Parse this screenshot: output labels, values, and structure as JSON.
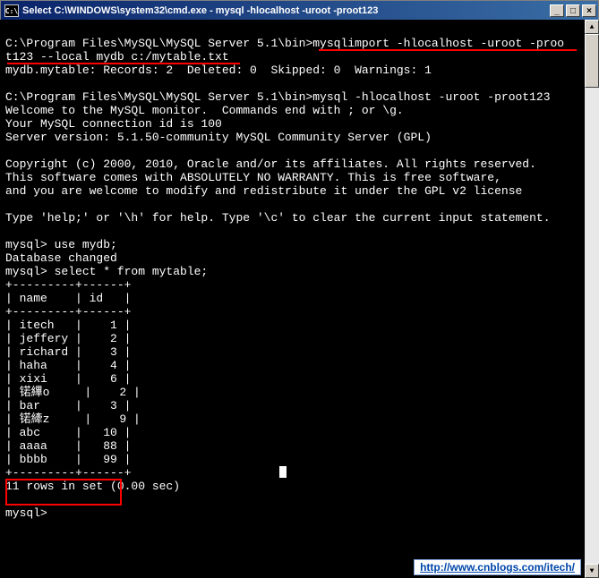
{
  "window": {
    "icon_label": "C:\\",
    "title": "Select C:\\WINDOWS\\system32\\cmd.exe - mysql -hlocalhost -uroot -proot123",
    "btn_min": "_",
    "btn_max": "□",
    "btn_close": "×"
  },
  "scroll": {
    "up": "▲",
    "down": "▼"
  },
  "terminal": {
    "line1": "C:\\Program Files\\MySQL\\MySQL Server 5.1\\bin>mysqlimport -hlocalhost -uroot -proo",
    "line2": "t123 --local mydb c:/mytable.txt",
    "line3": "mydb.mytable: Records: 2  Deleted: 0  Skipped: 0  Warnings: 1",
    "line5": "C:\\Program Files\\MySQL\\MySQL Server 5.1\\bin>mysql -hlocalhost -uroot -proot123",
    "line6": "Welcome to the MySQL monitor.  Commands end with ; or \\g.",
    "line7": "Your MySQL connection id is 100",
    "line8": "Server version: 5.1.50-community MySQL Community Server (GPL)",
    "line10": "Copyright (c) 2000, 2010, Oracle and/or its affiliates. All rights reserved.",
    "line11": "This software comes with ABSOLUTELY NO WARRANTY. This is free software,",
    "line12": "and you are welcome to modify and redistribute it under the GPL v2 license",
    "line14": "Type 'help;' or '\\h' for help. Type '\\c' to clear the current input statement.",
    "line16": "mysql> use mydb;",
    "line17": "Database changed",
    "line18": "mysql> select * from mytable;",
    "tbl_border": "+---------+------+",
    "tbl_header": "| name    | id   |",
    "prompt": "mysql> ",
    "summary": "11 rows in set (0.00 sec)"
  },
  "chart_data": {
    "type": "table",
    "columns": [
      "name",
      "id"
    ],
    "rows": [
      {
        "name": "itech",
        "id": 1
      },
      {
        "name": "jeffery",
        "id": 2
      },
      {
        "name": "richard",
        "id": 3
      },
      {
        "name": "haha",
        "id": 4
      },
      {
        "name": "xixi",
        "id": 6
      },
      {
        "name": "锘縪o",
        "id": 2
      },
      {
        "name": "bar",
        "id": 3
      },
      {
        "name": "锘縴z",
        "id": 9
      },
      {
        "name": "abc",
        "id": 10
      },
      {
        "name": "aaaa",
        "id": 88
      },
      {
        "name": "bbbb",
        "id": 99
      }
    ]
  },
  "watermark": "http://www.cnblogs.com/itech/"
}
